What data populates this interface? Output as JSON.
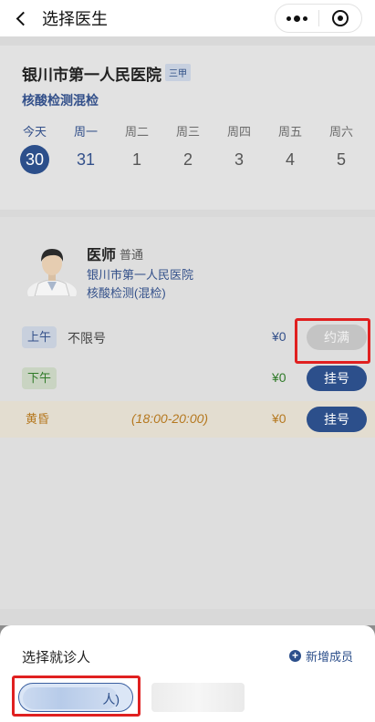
{
  "header": {
    "title": "选择医生"
  },
  "hospital": {
    "name": "银川市第一人民医院",
    "level": "三甲",
    "department": "核酸检测混检"
  },
  "week": [
    {
      "weekday": "今天",
      "date": "30",
      "selected": true
    },
    {
      "weekday": "周一",
      "date": "31"
    },
    {
      "weekday": "周二",
      "date": "1"
    },
    {
      "weekday": "周三",
      "date": "2"
    },
    {
      "weekday": "周四",
      "date": "3"
    },
    {
      "weekday": "周五",
      "date": "4"
    },
    {
      "weekday": "周六",
      "date": "5"
    }
  ],
  "doctor": {
    "title": "医师",
    "level": "普通",
    "hospital": "银川市第一人民医院",
    "department": "核酸检测(混检)"
  },
  "slots": [
    {
      "period": "上午",
      "desc": "不限号",
      "price": "¥0",
      "button": "约满"
    },
    {
      "period": "下午",
      "desc": "",
      "price": "¥0",
      "button": "挂号"
    },
    {
      "period": "黄昏",
      "desc": "(18:00-20:00)",
      "price": "¥0",
      "button": "挂号"
    }
  ],
  "sheet": {
    "title": "选择就诊人",
    "add_label": "新增成员",
    "patient_suffix": "人)"
  },
  "colors": {
    "accent": "#2c4f8b",
    "highlight": "#e02020"
  }
}
